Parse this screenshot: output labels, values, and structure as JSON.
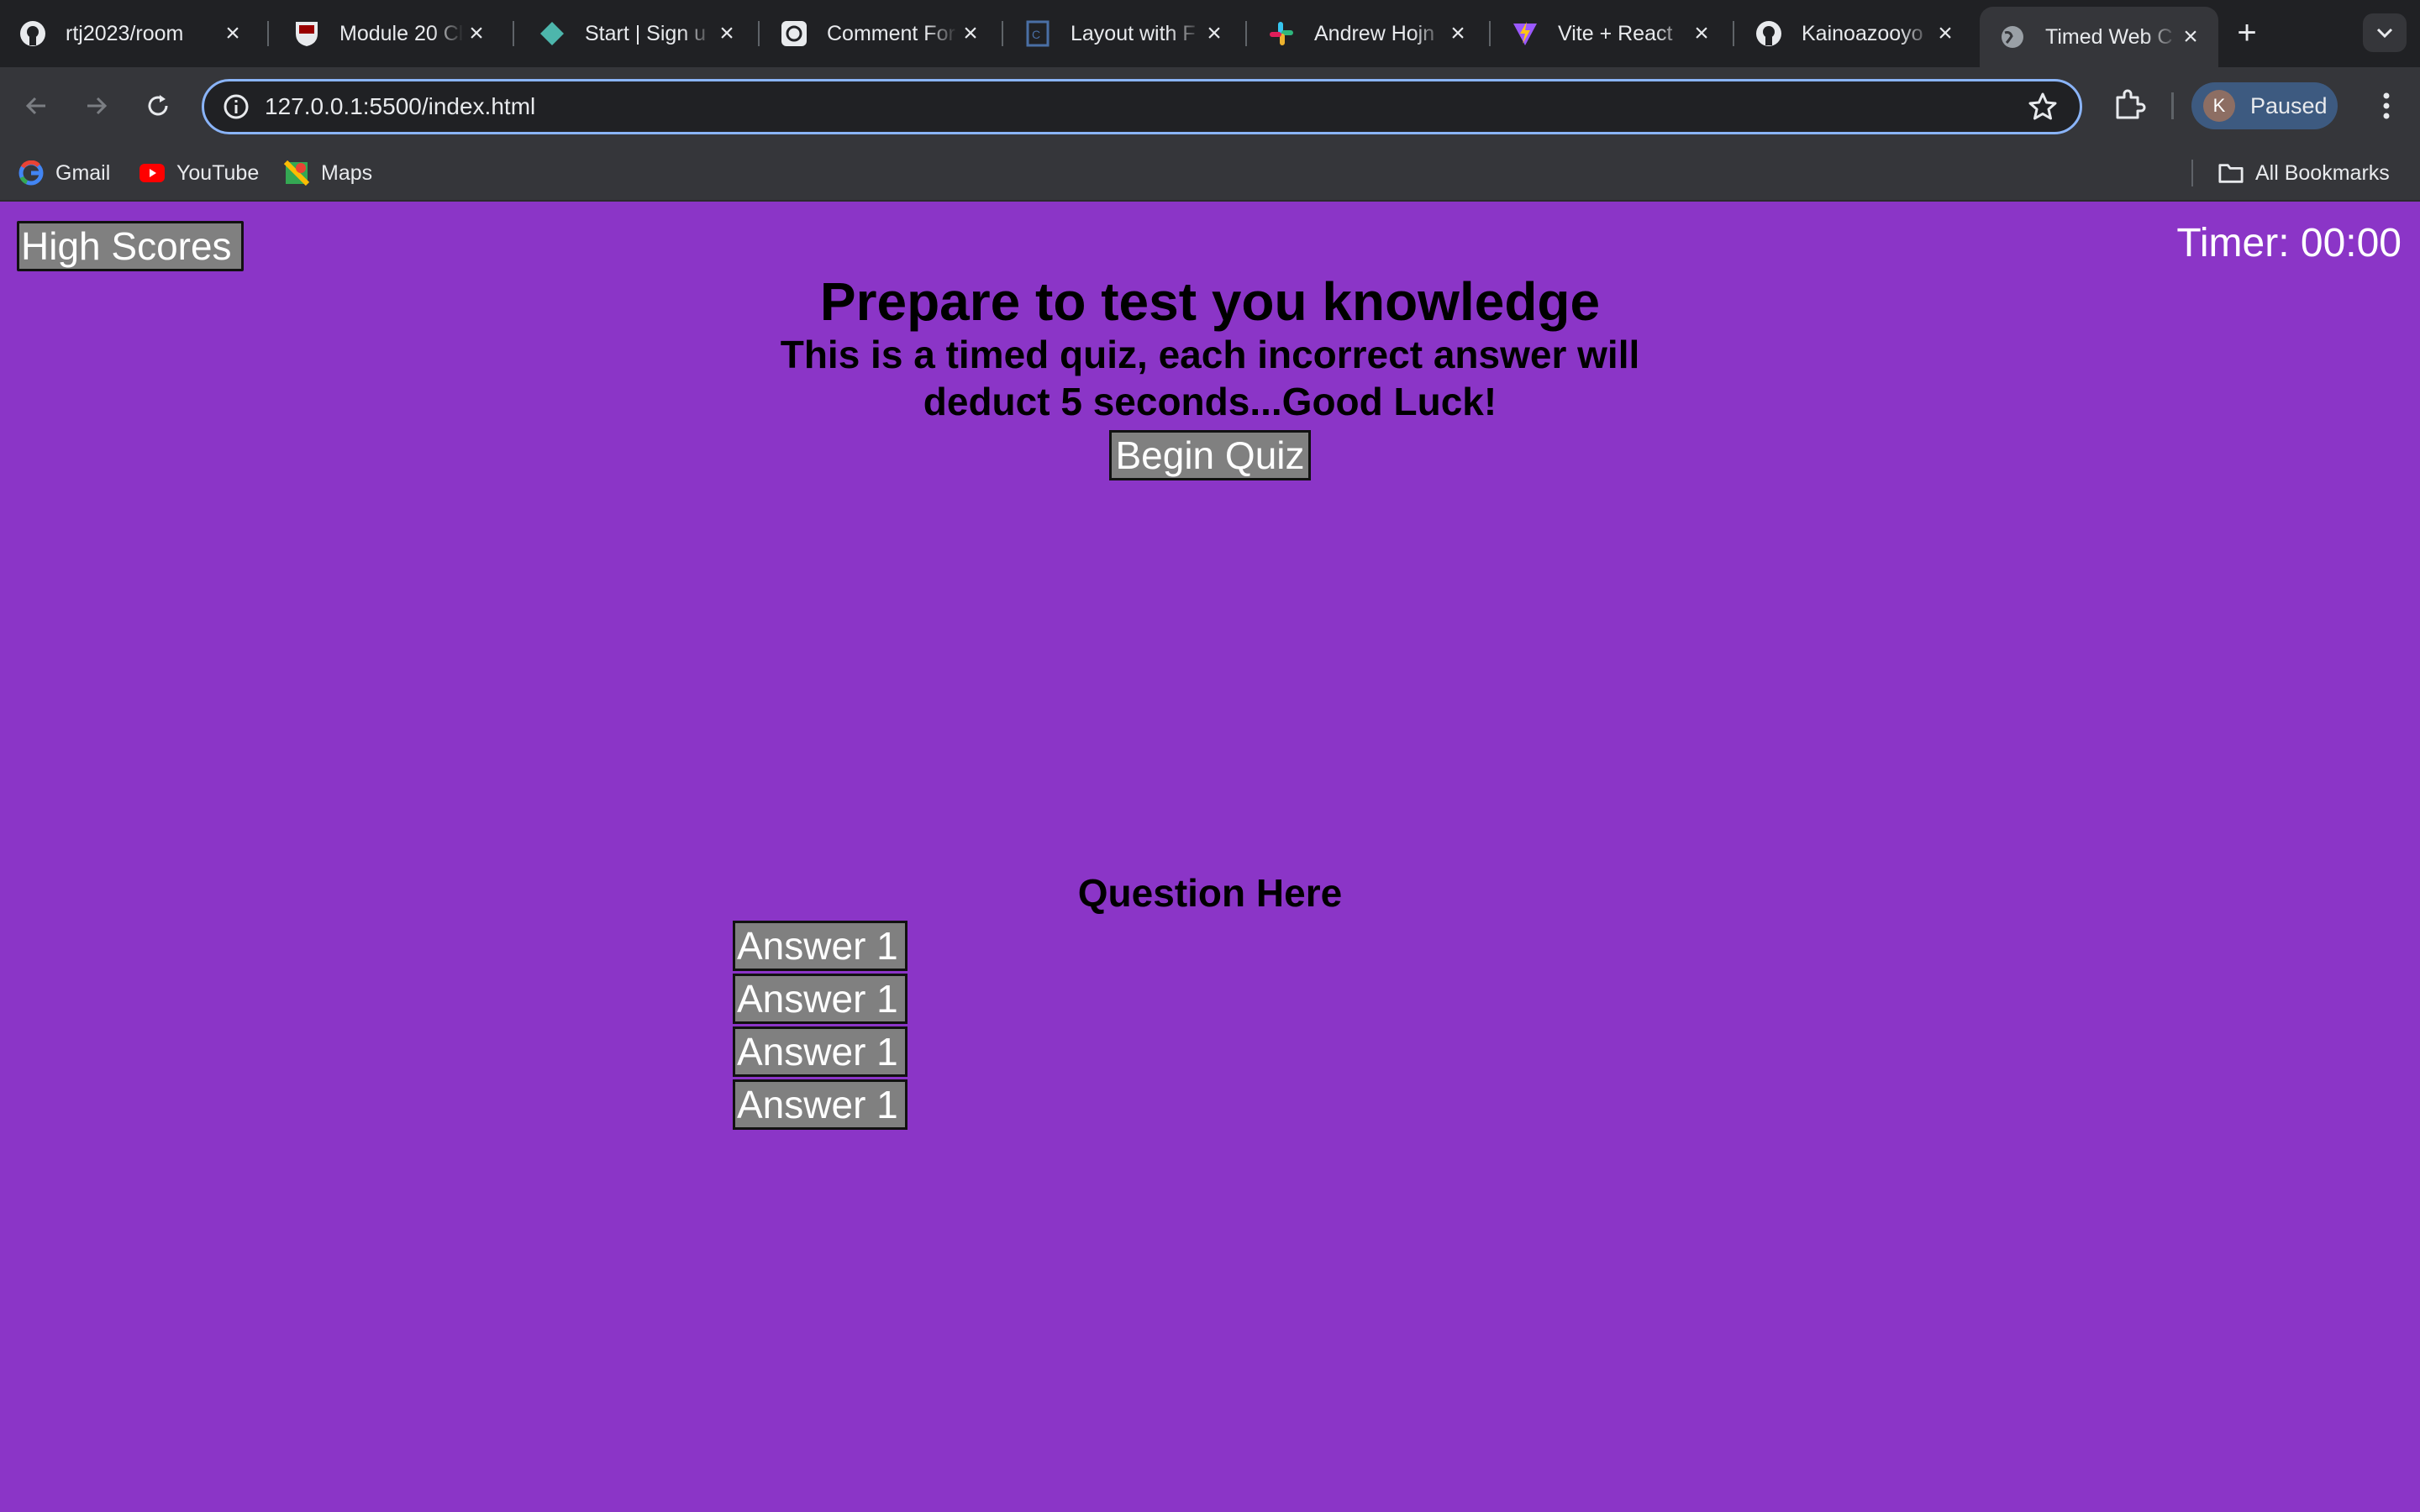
{
  "browser": {
    "tabs": [
      {
        "title": "rtj2023/room",
        "icon": "github-icon"
      },
      {
        "title": "Module 20 Cl",
        "icon": "university-shield-icon"
      },
      {
        "title": "Start | Sign u",
        "icon": "diamond-icon"
      },
      {
        "title": "Comment For",
        "icon": "openai-icon"
      },
      {
        "title": "Layout with F",
        "icon": "document-icon"
      },
      {
        "title": "Andrew Hojn",
        "icon": "slack-icon"
      },
      {
        "title": "Vite + React",
        "icon": "vite-icon"
      },
      {
        "title": "Kainoazooyo",
        "icon": "github-icon"
      },
      {
        "title": "Timed Web C",
        "icon": "globe-icon",
        "active": true
      }
    ],
    "url": "127.0.0.1:5500/index.html",
    "profile": {
      "initial": "K",
      "status": "Paused"
    },
    "bookmarks": [
      {
        "label": "Gmail",
        "icon": "google-icon"
      },
      {
        "label": "YouTube",
        "icon": "youtube-icon"
      },
      {
        "label": "Maps",
        "icon": "maps-icon"
      }
    ],
    "all_bookmarks": "All Bookmarks"
  },
  "page": {
    "high_scores_label": "High Scores",
    "timer_text": "Timer: 00:00",
    "title": "Prepare to test you knowledge",
    "subtitle_line1": "This is a timed quiz, each incorrect answer will",
    "subtitle_line2": "deduct 5 seconds...Good Luck!",
    "begin_label": "Begin Quiz",
    "question": "Question Here",
    "answers": [
      "Answer 1",
      "Answer 1",
      "Answer 1",
      "Answer 1"
    ]
  },
  "colors": {
    "page_background": "#8b35c7",
    "button_background": "#808080",
    "chrome_dark": "#202124",
    "chrome_toolbar": "#35363a",
    "focus_ring": "#8ab4f8"
  }
}
